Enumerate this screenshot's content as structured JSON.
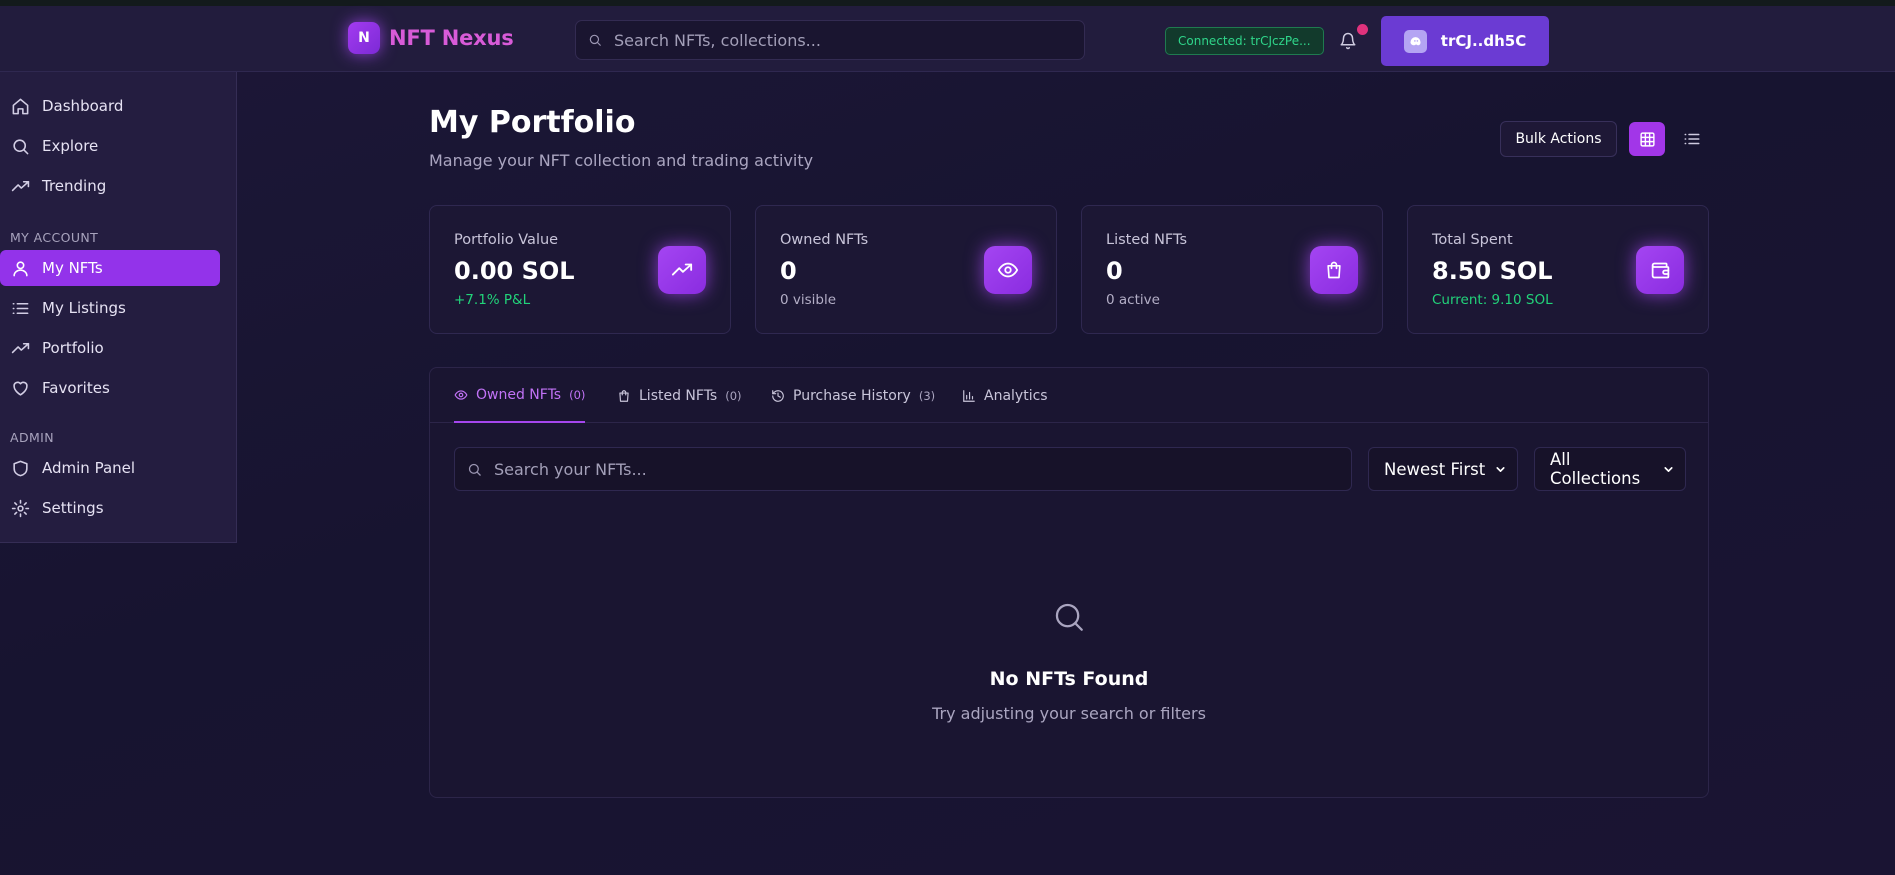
{
  "header": {
    "logo_letter": "N",
    "brand": "NFT Nexus",
    "search_placeholder": "Search NFTs, collections...",
    "connected": "Connected: trCJczPe...",
    "wallet": "trCJ..dh5C"
  },
  "sidebar": {
    "items": [
      {
        "label": "Dashboard",
        "icon": "home-icon"
      },
      {
        "label": "Explore",
        "icon": "search-icon"
      },
      {
        "label": "Trending",
        "icon": "trending-up-icon"
      }
    ],
    "my_account_title": "MY ACCOUNT",
    "account_items": [
      {
        "label": "My NFTs",
        "icon": "user-icon",
        "active": true
      },
      {
        "label": "My Listings",
        "icon": "list-icon"
      },
      {
        "label": "Portfolio",
        "icon": "trending-up-icon"
      },
      {
        "label": "Favorites",
        "icon": "heart-icon"
      }
    ],
    "admin_title": "ADMIN",
    "admin_items": [
      {
        "label": "Admin Panel",
        "icon": "shield-icon"
      },
      {
        "label": "Settings",
        "icon": "gear-icon"
      }
    ]
  },
  "page": {
    "title": "My Portfolio",
    "subtitle": "Manage your NFT collection and trading activity",
    "bulk_actions": "Bulk Actions"
  },
  "stats": [
    {
      "label": "Portfolio Value",
      "value": "0.00 SOL",
      "sub": "+7.1% P&L",
      "icon": "trending-up-icon"
    },
    {
      "label": "Owned NFTs",
      "value": "0",
      "sub": "0 visible",
      "icon": "eye-icon"
    },
    {
      "label": "Listed NFTs",
      "value": "0",
      "sub": "0 active",
      "icon": "shopping-bag-icon"
    },
    {
      "label": "Total Spent",
      "value": "8.50 SOL",
      "sub": "Current: 9.10 SOL",
      "icon": "wallet-icon"
    }
  ],
  "tabs": [
    {
      "label": "Owned NFTs",
      "count": "(0)",
      "icon": "eye-icon",
      "active": true
    },
    {
      "label": "Listed NFTs",
      "count": "(0)",
      "icon": "shopping-bag-icon"
    },
    {
      "label": "Purchase History",
      "count": "(3)",
      "icon": "history-icon"
    },
    {
      "label": "Analytics",
      "count": "",
      "icon": "bar-chart-icon"
    }
  ],
  "filters": {
    "search_placeholder": "Search your NFTs...",
    "sort": "Newest First",
    "collection": "All Collections"
  },
  "empty": {
    "title": "No NFTs Found",
    "subtitle": "Try adjusting your search or filters"
  },
  "colors": {
    "accent": "#9333ea",
    "positive": "#22d37a",
    "brand": "#d85bd8",
    "notification": "#e0327d"
  }
}
